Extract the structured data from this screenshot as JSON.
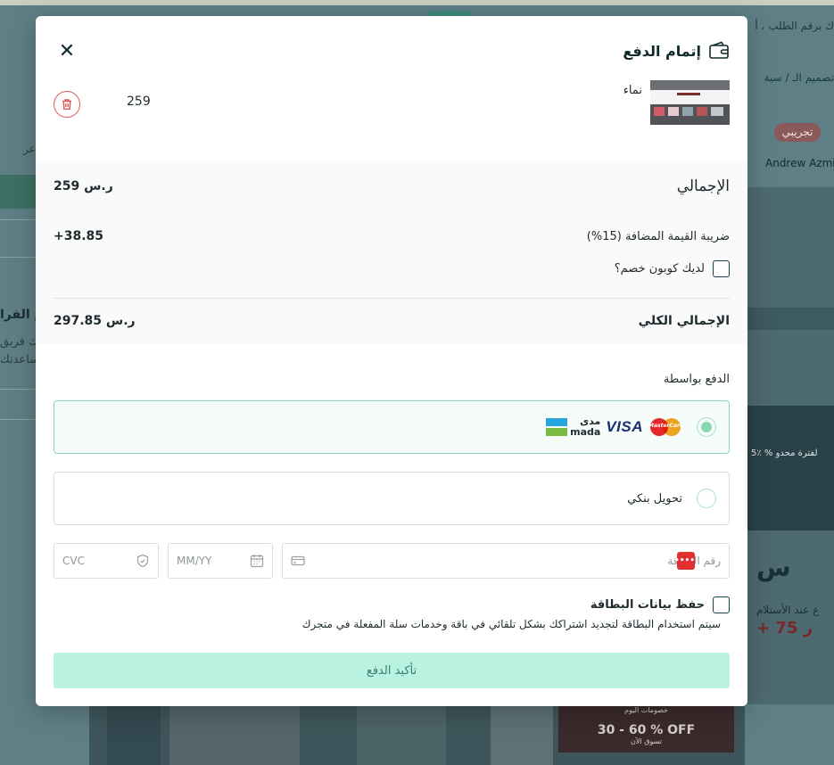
{
  "background": {
    "breadcrumb_lines": [
      "تصميم الـ  /  سية",
      "ك برقم الطلب ، أ"
    ],
    "badge": "تجريبي",
    "author": "Andrew Azmi",
    "promo": "5٪ % لفترة محدو",
    "receipt_line": "ع عند الأستلام",
    "price_hint": "+ 75 ر",
    "left_text": "عر",
    "left_heading": "م الفرا",
    "left_p1": "ك فريق",
    "left_p2": "ساعدتك",
    "offer_big": "30 - 60 % OFF",
    "offer_small": "خصومات اليوم",
    "offer_sub": "تسوق الآن"
  },
  "modal": {
    "title": "إتمام الدفع",
    "close_symbol": "✕",
    "product": {
      "name": "نماء",
      "price": "259"
    },
    "summary": {
      "subtotal_label": "الإجمالي",
      "subtotal_value": "259 ر.س",
      "vat_label": "ضريبة القيمة المضافة (15%)",
      "vat_value": "+38.85",
      "coupon_label": "لديك كوبون خصم؟",
      "grand_label": "الإجمالي الكلي",
      "grand_value": "297.85 ر.س"
    },
    "payment": {
      "heading": "الدفع بواسطة",
      "options": [
        {
          "id": "card",
          "selected": true,
          "logos": [
            "mastercard",
            "visa",
            "mada"
          ]
        },
        {
          "id": "bank",
          "selected": false,
          "label": "تحويل بنكي"
        }
      ],
      "visa_text": "VISA",
      "mastercard_text": "MasterCard",
      "mada_ar": "مدى",
      "mada_en": "mada",
      "card_number_placeholder": "رقم البطاقة",
      "card_red_text": "••••",
      "expiry_placeholder": "MM/YY",
      "cvc_placeholder": "CVC",
      "save_card_label": "حفظ بيانات البطاقة",
      "save_card_note": "سيتم استخدام البطاقة لتجديد اشتراكك بشكل تلقائي في باقة وخدمات سلة المفعلة في متجرك",
      "confirm_label": "تأكيد الدفع"
    },
    "colors": {
      "accent": "#baf2e2",
      "accent_text": "#3a7c6c",
      "selected_border": "#8ad7b3",
      "delete": "#e0585a",
      "dark": "#0f2a2c"
    }
  }
}
